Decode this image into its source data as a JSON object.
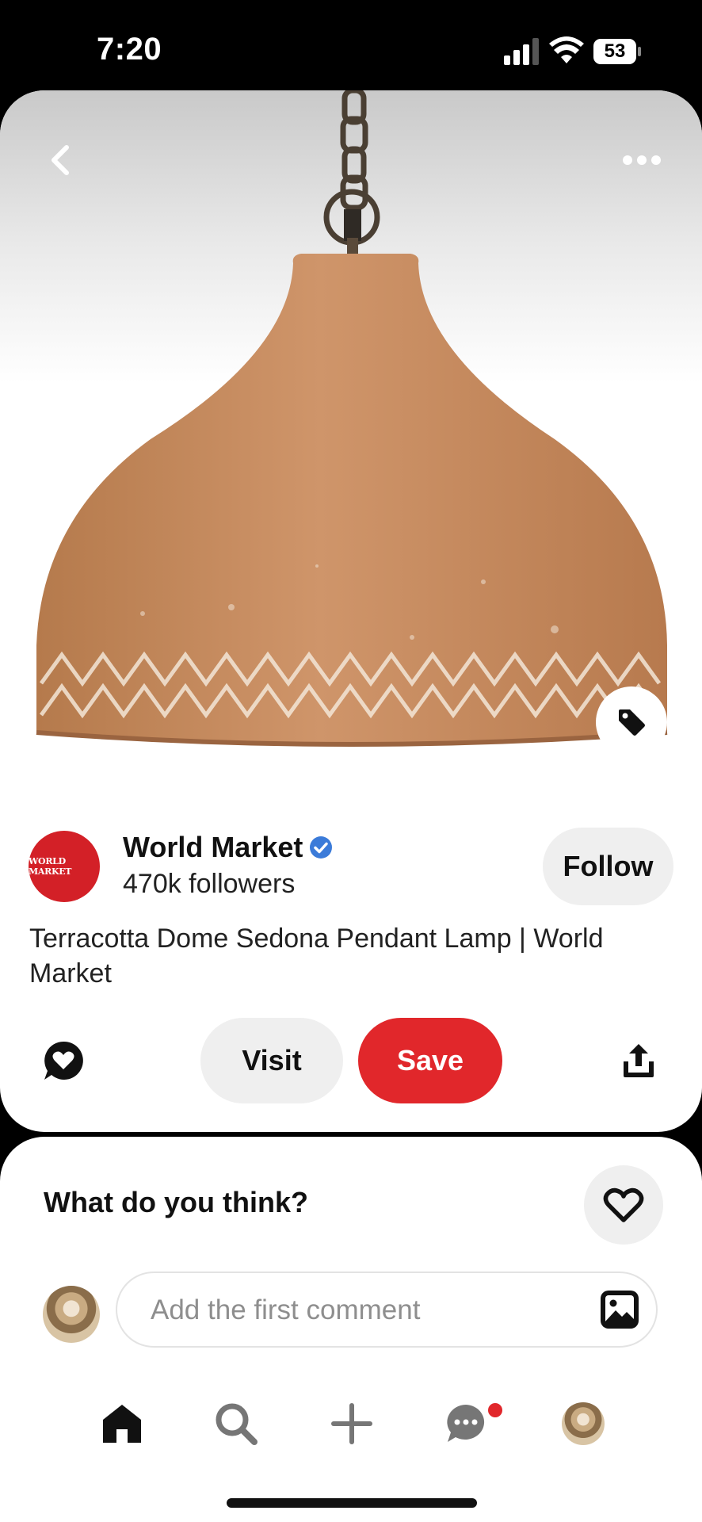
{
  "status_bar": {
    "time": "7:20",
    "battery_level": "53",
    "icons": [
      "cellular-signal-icon",
      "wifi-icon",
      "battery-icon"
    ]
  },
  "pin": {
    "image_icons": [
      "back-chevron-icon",
      "more-dots-icon",
      "price-tag-icon"
    ],
    "creator": {
      "name": "World Market",
      "followers": "470k followers",
      "avatar_text": "WORLD MARKET",
      "verified": true
    },
    "follow_label": "Follow",
    "title": "Terracotta Dome Sedona Pendant Lamp | World Market",
    "actions": {
      "visit_label": "Visit",
      "save_label": "Save",
      "reaction_icon": "heart-speech-bubble-icon",
      "share_icon": "share-upload-icon"
    }
  },
  "comments": {
    "heading": "What do you think?",
    "placeholder": "Add the first comment",
    "react_icon": "heart-outline-icon",
    "photo_icon": "image-icon"
  },
  "bottom_nav": {
    "items": [
      "home-icon",
      "search-icon",
      "create-plus-icon",
      "messages-icon",
      "profile-avatar"
    ],
    "messages_has_notification": true
  },
  "colors": {
    "brand_red": "#e1272b",
    "verified_blue": "#3b7bd9",
    "avatar_red": "#d32027",
    "lamp_terracotta": "#c48a5c"
  }
}
